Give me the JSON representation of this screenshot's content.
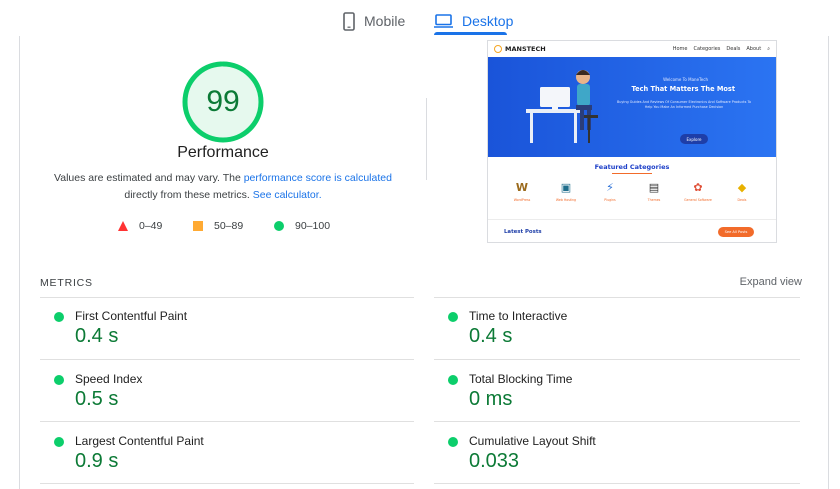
{
  "tabs": {
    "mobile_label": "Mobile",
    "desktop_label": "Desktop",
    "selected": "Desktop"
  },
  "score": {
    "value": "99",
    "fraction": 0.99,
    "label": "Performance",
    "color": "#0cce6b"
  },
  "description": {
    "text_before": "Values are estimated and may vary. The ",
    "link1": "performance score is calculated",
    "text_middle": " directly from these metrics. ",
    "link2": "See calculator."
  },
  "legend": [
    {
      "range": "0–49",
      "shape": "triangle",
      "color": "#ff3333"
    },
    {
      "range": "50–89",
      "shape": "square",
      "color": "#ffaa33"
    },
    {
      "range": "90–100",
      "shape": "circle",
      "color": "#0cce6b"
    }
  ],
  "screenshot": {
    "logo": "MANSTECH",
    "nav": [
      "Home",
      "Categories",
      "Deals",
      "About"
    ],
    "hero_small": "Welcome To ManeTech",
    "hero_title": "Tech That Matters The Most",
    "hero_sub": "Buying Guides And Reviews Of Consumer Electronics And Software Products To Help You Make An Informed Purchase Decision",
    "hero_button": "Explore",
    "featured_title": "Featured Categories",
    "categories": [
      {
        "label": "WordPress",
        "icon": "W",
        "color": "#9b6a1c"
      },
      {
        "label": "Web Hosting",
        "icon": "▣",
        "color": "#1f6e8c"
      },
      {
        "label": "Plugins",
        "icon": "⚡",
        "color": "#2a6fd6"
      },
      {
        "label": "Themes",
        "icon": "▤",
        "color": "#333333"
      },
      {
        "label": "General Software",
        "icon": "✿",
        "color": "#e0523a"
      },
      {
        "label": "Deals",
        "icon": "◆",
        "color": "#e8b100"
      }
    ],
    "latest_title": "Latest Posts",
    "latest_button": "See All Posts"
  },
  "metrics": {
    "heading": "METRICS",
    "expand_label": "Expand view",
    "items": [
      {
        "name": "First Contentful Paint",
        "value": "0.4 s"
      },
      {
        "name": "Time to Interactive",
        "value": "0.4 s"
      },
      {
        "name": "Speed Index",
        "value": "0.5 s"
      },
      {
        "name": "Total Blocking Time",
        "value": "0 ms"
      },
      {
        "name": "Largest Contentful Paint",
        "value": "0.9 s"
      },
      {
        "name": "Cumulative Layout Shift",
        "value": "0.033"
      }
    ]
  }
}
